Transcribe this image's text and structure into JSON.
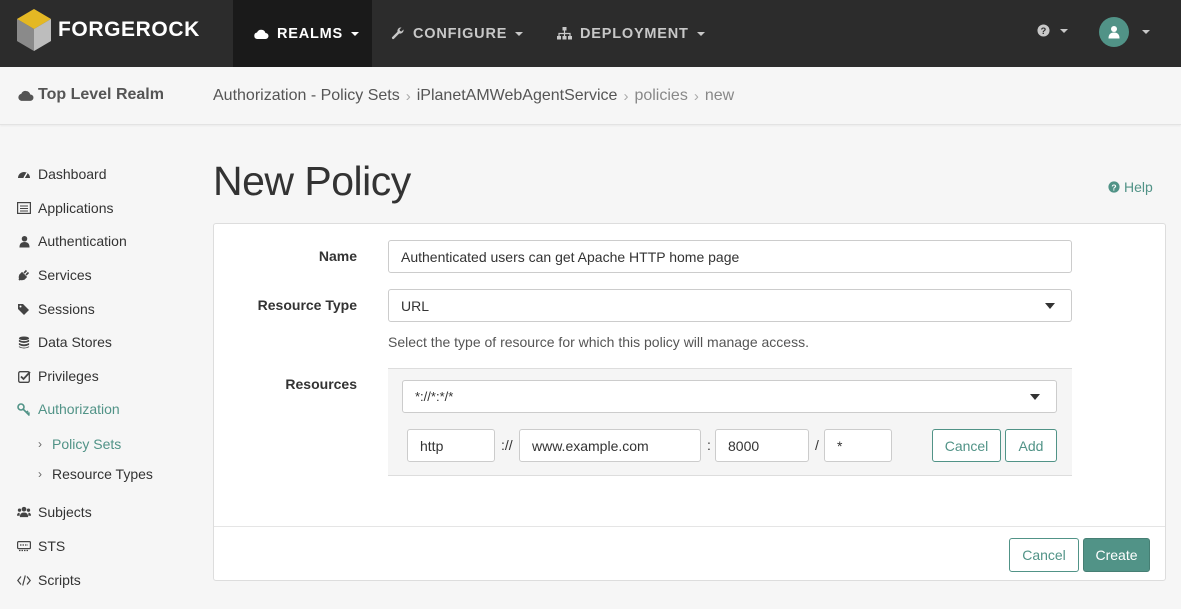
{
  "brand": {
    "name": "FORGEROCK",
    "accent": "#519387"
  },
  "nav": {
    "items": [
      {
        "label": "REALMS",
        "icon": "cloud-icon",
        "active": true
      },
      {
        "label": "CONFIGURE",
        "icon": "wrench-icon",
        "active": false
      },
      {
        "label": "DEPLOYMENT",
        "icon": "sitemap-icon",
        "active": false
      }
    ],
    "help_icon": "question-circle-icon",
    "user_icon": "user-icon"
  },
  "breadcrumb": {
    "realm": "Top Level Realm",
    "items": [
      "Authorization - Policy Sets",
      "iPlanetAMWebAgentService",
      "policies",
      "new"
    ]
  },
  "sidebar": {
    "items": [
      {
        "label": "Dashboard",
        "icon": "dashboard-icon"
      },
      {
        "label": "Applications",
        "icon": "list-alt-icon"
      },
      {
        "label": "Authentication",
        "icon": "user-icon"
      },
      {
        "label": "Services",
        "icon": "plug-icon"
      },
      {
        "label": "Sessions",
        "icon": "tags-icon"
      },
      {
        "label": "Data Stores",
        "icon": "database-icon"
      },
      {
        "label": "Privileges",
        "icon": "check-square-icon"
      },
      {
        "label": "Authorization",
        "icon": "key-icon"
      }
    ],
    "sub_items": [
      {
        "label": "Policy Sets",
        "active": true
      },
      {
        "label": "Resource Types",
        "active": false
      }
    ],
    "items_after": [
      {
        "label": "Subjects",
        "icon": "users-icon"
      },
      {
        "label": "STS",
        "icon": "sts-icon"
      },
      {
        "label": "Scripts",
        "icon": "code-icon"
      }
    ]
  },
  "main": {
    "title": "New Policy",
    "help_label": "Help"
  },
  "form": {
    "name_label": "Name",
    "name_value": "Authenticated users can get Apache HTTP home page",
    "resource_type_label": "Resource Type",
    "resource_type_value": "URL",
    "resource_type_hint": "Select the type of resource for which this policy will manage access.",
    "resources_label": "Resources",
    "resource_pattern": "*://*:*/*",
    "scheme": "http",
    "scheme_sep": "://",
    "host": "www.example.com",
    "port_sep": ":",
    "port": "8000",
    "path_sep": "/",
    "path": "*",
    "resource_cancel": "Cancel",
    "resource_add": "Add"
  },
  "footer": {
    "cancel_label": "Cancel",
    "create_label": "Create"
  }
}
